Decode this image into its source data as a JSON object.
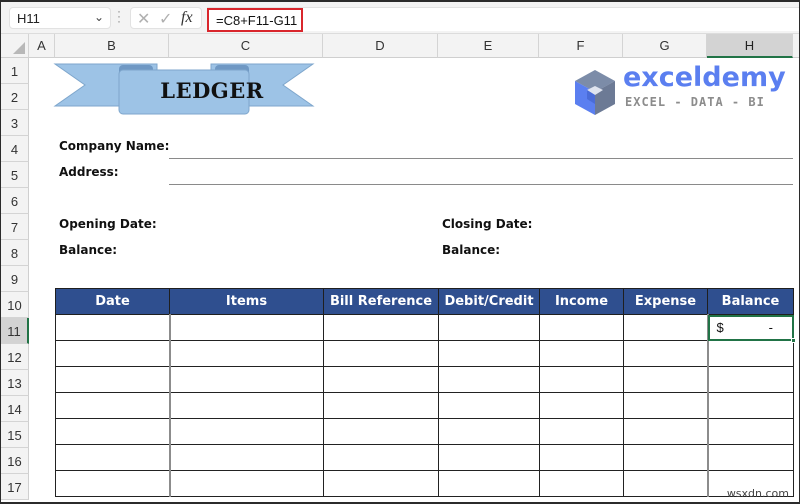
{
  "formula_bar": {
    "name_box": "H11",
    "formula": "=C8+F11-G11",
    "icons": [
      "chevron-down-icon",
      "more-options-icon",
      "cancel-icon",
      "enter-icon",
      "insert-function-icon"
    ]
  },
  "columns": [
    {
      "label": "A",
      "selected": false
    },
    {
      "label": "B",
      "selected": false
    },
    {
      "label": "C",
      "selected": false
    },
    {
      "label": "D",
      "selected": false
    },
    {
      "label": "E",
      "selected": false
    },
    {
      "label": "F",
      "selected": false
    },
    {
      "label": "G",
      "selected": false
    },
    {
      "label": "H",
      "selected": true
    }
  ],
  "rows": [
    "1",
    "2",
    "3",
    "4",
    "5",
    "6",
    "7",
    "8",
    "9",
    "10",
    "11",
    "12",
    "13",
    "14",
    "15",
    "16",
    "17"
  ],
  "selected_row": "11",
  "banner": {
    "title": "LEDGER",
    "color": "#9dc3e6"
  },
  "logo": {
    "name": "exceldemy",
    "tagline": "EXCEL - DATA - BI",
    "color": "#5b7ff0"
  },
  "form": {
    "company_name_label": "Company Name:",
    "address_label": "Address:",
    "opening_date_label": "Opening Date:",
    "opening_balance_label": "Balance:",
    "closing_date_label": "Closing Date:",
    "closing_balance_label": "Balance:"
  },
  "table": {
    "header_color": "#2f4f8f",
    "headers": [
      "Date",
      "Items",
      "Bill Reference",
      "Debit/Credit",
      "Income",
      "Expense",
      "Balance"
    ],
    "rows": [
      [
        "",
        "",
        "",
        "",
        "",
        "",
        "$ -"
      ],
      [
        "",
        "",
        "",
        "",
        "",
        "",
        ""
      ],
      [
        "",
        "",
        "",
        "",
        "",
        "",
        ""
      ],
      [
        "",
        "",
        "",
        "",
        "",
        "",
        ""
      ],
      [
        "",
        "",
        "",
        "",
        "",
        "",
        ""
      ],
      [
        "",
        "",
        "",
        "",
        "",
        "",
        ""
      ],
      [
        "",
        "",
        "",
        "",
        "",
        "",
        ""
      ]
    ],
    "active_cell": {
      "currency": "$",
      "value": "-"
    }
  },
  "watermark": "wsxdn.com"
}
